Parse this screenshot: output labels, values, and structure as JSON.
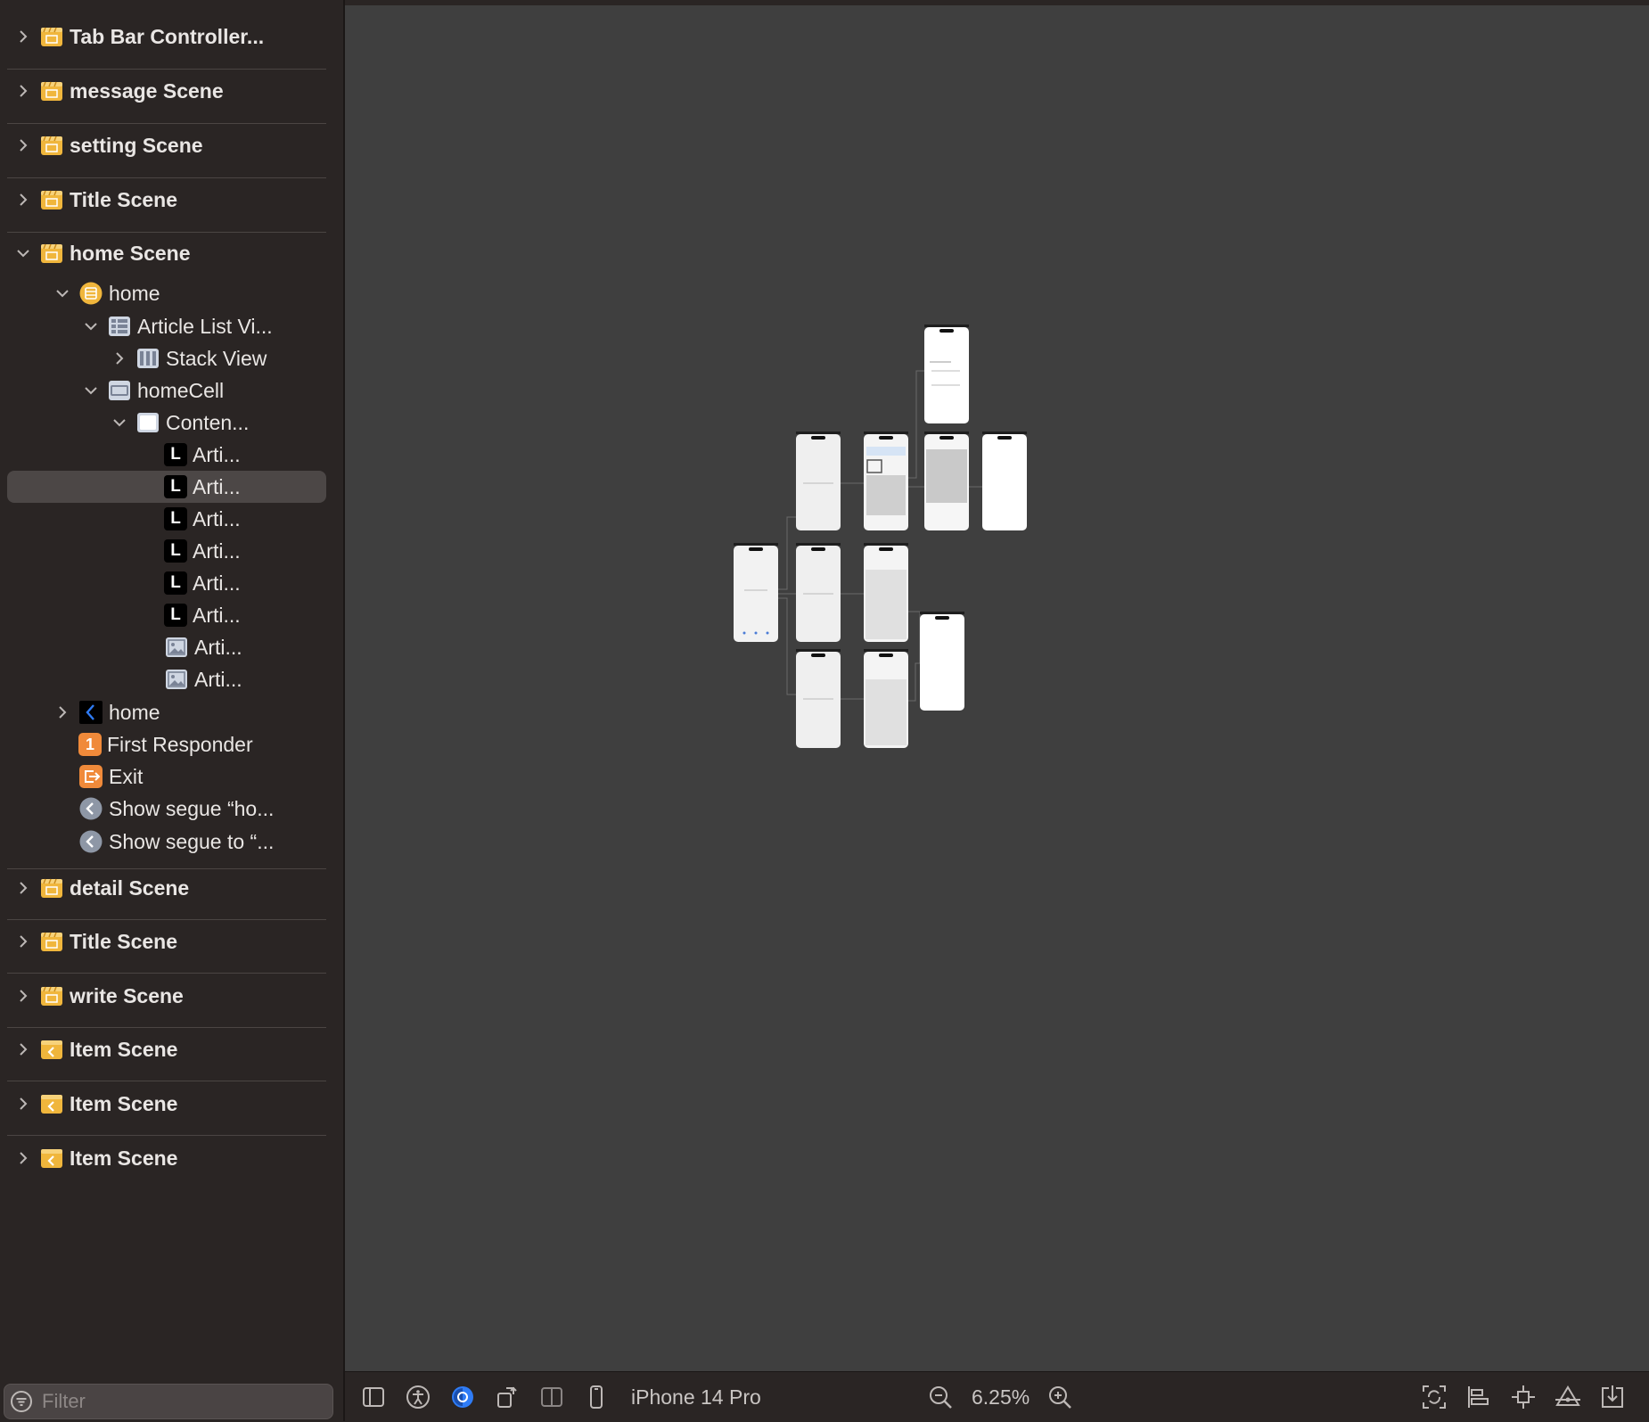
{
  "outline": {
    "scenes_top": [
      {
        "label": "Tab Bar Controller...",
        "icon": "scene-icon"
      },
      {
        "label": "message Scene",
        "icon": "scene-icon"
      },
      {
        "label": "setting Scene",
        "icon": "scene-icon"
      },
      {
        "label": "Title Scene",
        "icon": "scene-icon"
      },
      {
        "label": "home Scene",
        "icon": "scene-icon"
      }
    ],
    "home_children": [
      {
        "label": "home",
        "icon": "view-controller-icon"
      },
      {
        "label": "Article List Vi...",
        "icon": "table-view-icon"
      },
      {
        "label": "Stack View",
        "icon": "stack-view-icon"
      },
      {
        "label": "homeCell",
        "icon": "table-cell-icon"
      },
      {
        "label": "Conten...",
        "icon": "view-icon"
      },
      {
        "label": "Arti...",
        "icon": "label-icon",
        "glyph": "L"
      },
      {
        "label": "Arti...",
        "icon": "label-icon",
        "glyph": "L"
      },
      {
        "label": "Arti...",
        "icon": "label-icon",
        "glyph": "L"
      },
      {
        "label": "Arti...",
        "icon": "label-icon",
        "glyph": "L"
      },
      {
        "label": "Arti...",
        "icon": "label-icon",
        "glyph": "L"
      },
      {
        "label": "Arti...",
        "icon": "label-icon",
        "glyph": "L"
      },
      {
        "label": "Arti...",
        "icon": "image-view-icon"
      },
      {
        "label": "Arti...",
        "icon": "image-view-icon"
      },
      {
        "label": "home",
        "icon": "navigation-item-icon"
      },
      {
        "label": "First Responder",
        "icon": "first-responder-icon",
        "glyph": "1"
      },
      {
        "label": "Exit",
        "icon": "exit-icon"
      },
      {
        "label": "Show segue “ho...",
        "icon": "segue-icon"
      },
      {
        "label": "Show segue to “...",
        "icon": "segue-icon"
      }
    ],
    "scenes_bottom": [
      {
        "label": "detail Scene",
        "icon": "scene-icon"
      },
      {
        "label": "Title Scene",
        "icon": "scene-icon"
      },
      {
        "label": "write Scene",
        "icon": "scene-icon"
      },
      {
        "label": "Item Scene",
        "icon": "item-scene-icon"
      },
      {
        "label": "Item Scene",
        "icon": "item-scene-icon"
      },
      {
        "label": "Item Scene",
        "icon": "item-scene-icon"
      }
    ],
    "filter_placeholder": "Filter"
  },
  "toolbar": {
    "device": "iPhone 14 Pro",
    "zoom": "6.25%",
    "icons": [
      "sidebar-toggle-icon",
      "accessibility-icon",
      "appearance-icon",
      "orientation-icon",
      "split-view-icon",
      "device-icon",
      "zoom-out-icon",
      "zoom-in-icon",
      "update-frames-icon",
      "align-icon",
      "add-constraints-icon",
      "resolve-issues-icon",
      "embed-in-icon"
    ]
  },
  "colors": {
    "sidebar_bg": "#2a2524",
    "canvas_bg": "#3f3f3f",
    "scene_icon": "#f0b63c",
    "selection": "#4c4746",
    "accent_blue": "#2f7cf6",
    "orange": "#f08a3a"
  }
}
